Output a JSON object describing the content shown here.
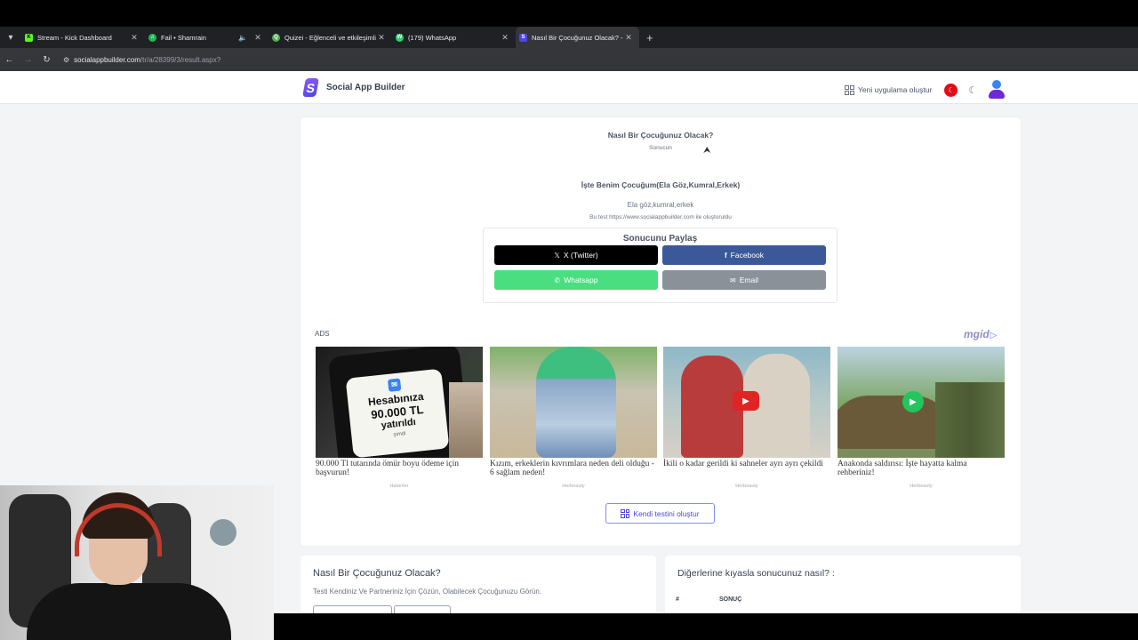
{
  "browser": {
    "tabs": [
      {
        "title": "Stream - Kick Dashboard",
        "favicon_color": "#53fc18",
        "favicon_letter": "K",
        "active": false
      },
      {
        "title": "Fail • Shamrain",
        "favicon_color": "#1db954",
        "favicon_letter": "♫",
        "active": false,
        "audio": true
      },
      {
        "title": "Quizei - Eğlenceli ve etkileşimli",
        "favicon_color": "#4caf50",
        "favicon_letter": "Q",
        "active": false
      },
      {
        "title": "(179) WhatsApp",
        "favicon_color": "#25d366",
        "favicon_letter": "W",
        "active": false
      },
      {
        "title": "Nasıl Bir Çocuğunuz Olacak? - S",
        "favicon_color": "#4f46e5",
        "favicon_letter": "S",
        "active": true
      }
    ],
    "url_host": "socialappbuilder.com",
    "url_path": "/tr/a/28399/3/result.aspx?"
  },
  "header": {
    "brand": "Social App Builder",
    "new_app": "Yeni uygulama oluştur"
  },
  "quiz": {
    "title": "Nasıl Bir Çocuğunuz Olacak?",
    "subtitle": "Sonucun",
    "result_title": "İşte Benim Çocuğum(Ela Göz,Kumral,Erkek)",
    "result_desc": "Ela göz,kumral,erkek",
    "result_note": "Bu test https://www.socialappbuilder.com ile oluşturuldu"
  },
  "share": {
    "title": "Sonucunu Paylaş",
    "twitter": "X (Twitter)",
    "facebook": "Facebook",
    "whatsapp": "Whatsapp",
    "email": "Email"
  },
  "ads": {
    "label": "ADS",
    "network": "mgid",
    "items": [
      {
        "title": "90.000 Tl tutarında ömür boyu ödeme için başvurun!",
        "source": "Haberler",
        "image_text": [
          "Hesabınıza",
          "90.000 TL",
          "yatırıldı",
          "şimdi"
        ],
        "video": false
      },
      {
        "title": "Kızım, erkeklerin kıvrımlara neden deli olduğu - 6 sağlam neden!",
        "source": "Herbeauty",
        "video": false
      },
      {
        "title": "İkili o kadar gerildi ki sahneler ayrı ayrı çekildi",
        "source": "Herbeauty",
        "video": true
      },
      {
        "title": "Anakonda saldırısı: İşte hayatta kalma rehberiniz!",
        "source": "Herbeauty",
        "video": true
      }
    ]
  },
  "create_own": "Kendi testini oluştur",
  "bottom_left": {
    "title": "Nasıl Bir Çocuğunuz Olacak?",
    "desc": "Testi Kendiniz Ve Partneriniz İçin Çözün, Olabilecek Çocuğunuzu Görün."
  },
  "bottom_right": {
    "title": "Diğerlerine kıyasla sonucunuz nasıl? :",
    "col_hash": "#",
    "col_result": "SONUÇ"
  },
  "colors": {
    "twitter": "#000000",
    "facebook": "#3b5998",
    "whatsapp": "#4ade80",
    "email": "#8a9199",
    "accent": "#4f46e5"
  }
}
